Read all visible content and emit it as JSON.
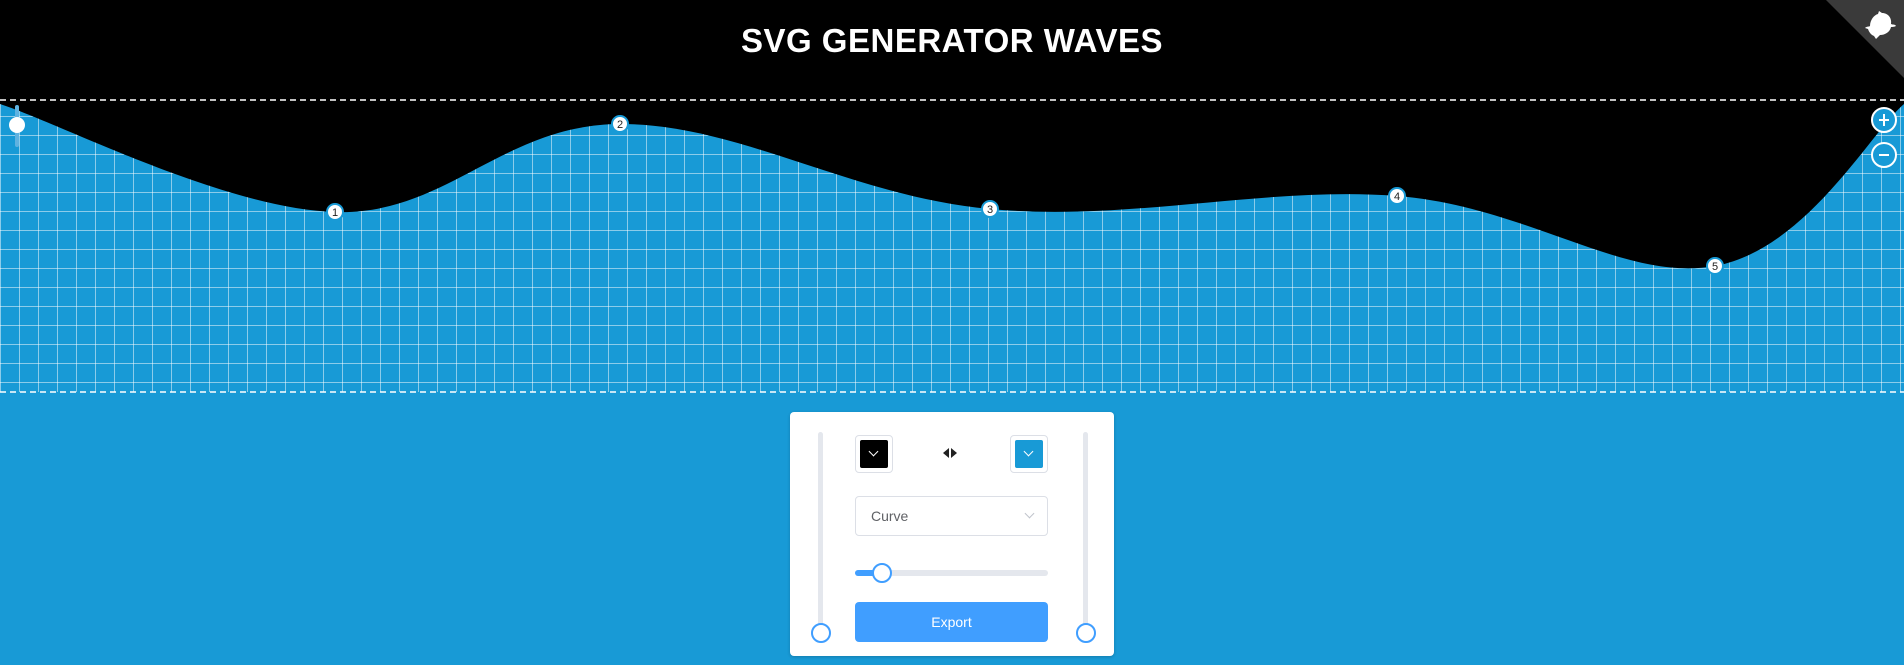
{
  "header": {
    "title": "SVG GENERATOR WAVES"
  },
  "colors": {
    "background": "#000000",
    "wave": "#189ad6",
    "accent": "#409eff"
  },
  "corner_link": {
    "icon": "github-octocat-icon"
  },
  "wave": {
    "points": [
      {
        "label": "1"
      },
      {
        "label": "2"
      },
      {
        "label": "3"
      },
      {
        "label": "4"
      },
      {
        "label": "5"
      }
    ]
  },
  "zoom": {
    "in_icon": "plus-icon",
    "out_icon": "minus-icon"
  },
  "controls": {
    "color_top": "#000000",
    "color_bottom": "#189ad6",
    "swap_icon": "swap-arrows-icon",
    "curve_type": "Curve",
    "smoothness_fraction": 0.1,
    "left_slider_fraction": 0.0,
    "right_slider_fraction": 0.0,
    "export_label": "Export"
  }
}
